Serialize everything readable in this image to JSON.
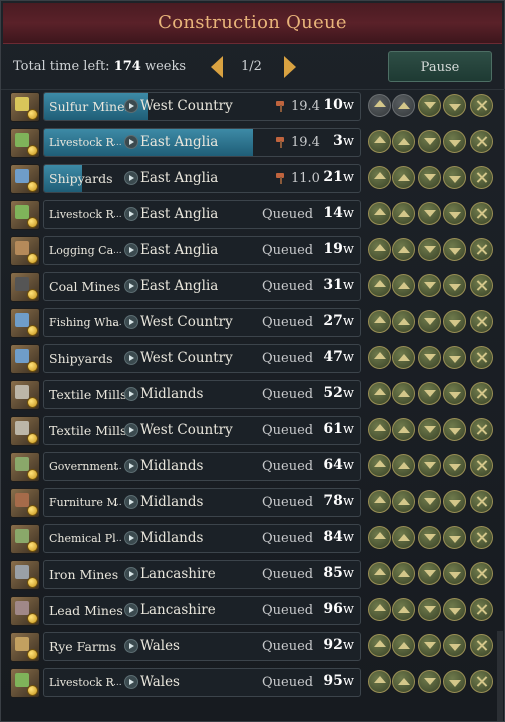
{
  "title": "Construction Queue",
  "total_time": {
    "label": "Total time left:",
    "value": "174",
    "unit": "weeks"
  },
  "page_indicator": "1/2",
  "pause_label": "Pause",
  "rows": [
    {
      "building": "Sulfur Mines",
      "state": "West Country",
      "status": "",
      "rate": "19.4",
      "weeks": "10",
      "unit": "w",
      "progress": 0.33,
      "icon": "sulfur-mine-icon",
      "small": false
    },
    {
      "building": "Livestock R",
      "state": "East Anglia",
      "status": "",
      "rate": "19.4",
      "weeks": "3",
      "unit": "w",
      "progress": 0.66,
      "icon": "livestock-ranch-icon",
      "small": true
    },
    {
      "building": "Shipyards",
      "state": "East Anglia",
      "status": "",
      "rate": "11.0",
      "weeks": "21",
      "unit": "w",
      "progress": 0.12,
      "icon": "shipyard-icon",
      "small": false
    },
    {
      "building": "Livestock R",
      "state": "East Anglia",
      "status": "Queued",
      "rate": "",
      "weeks": "14",
      "unit": "w",
      "progress": 0,
      "icon": "livestock-ranch-icon",
      "small": true
    },
    {
      "building": "Logging Ca",
      "state": "East Anglia",
      "status": "Queued",
      "rate": "",
      "weeks": "19",
      "unit": "w",
      "progress": 0,
      "icon": "logging-camp-icon",
      "small": true
    },
    {
      "building": "Coal Mines",
      "state": "East Anglia",
      "status": "Queued",
      "rate": "",
      "weeks": "31",
      "unit": "w",
      "progress": 0,
      "icon": "coal-mine-icon",
      "small": false
    },
    {
      "building": "Fishing Wha",
      "state": "West Country",
      "status": "Queued",
      "rate": "",
      "weeks": "27",
      "unit": "w",
      "progress": 0,
      "icon": "fishing-wharf-icon",
      "small": true
    },
    {
      "building": "Shipyards",
      "state": "West Country",
      "status": "Queued",
      "rate": "",
      "weeks": "47",
      "unit": "w",
      "progress": 0,
      "icon": "shipyard-icon",
      "small": false
    },
    {
      "building": "Textile Mills",
      "state": "Midlands",
      "status": "Queued",
      "rate": "",
      "weeks": "52",
      "unit": "w",
      "progress": 0,
      "icon": "textile-mill-icon",
      "small": false
    },
    {
      "building": "Textile Mills",
      "state": "West Country",
      "status": "Queued",
      "rate": "",
      "weeks": "61",
      "unit": "w",
      "progress": 0,
      "icon": "textile-mill-icon",
      "small": false
    },
    {
      "building": "Government",
      "state": "Midlands",
      "status": "Queued",
      "rate": "",
      "weeks": "64",
      "unit": "w",
      "progress": 0,
      "icon": "government-admin-icon",
      "small": true
    },
    {
      "building": "Furniture M",
      "state": "Midlands",
      "status": "Queued",
      "rate": "",
      "weeks": "78",
      "unit": "w",
      "progress": 0,
      "icon": "furniture-manufactory-icon",
      "small": true
    },
    {
      "building": "Chemical Pl",
      "state": "Midlands",
      "status": "Queued",
      "rate": "",
      "weeks": "84",
      "unit": "w",
      "progress": 0,
      "icon": "chemical-plant-icon",
      "small": true
    },
    {
      "building": "Iron Mines",
      "state": "Lancashire",
      "status": "Queued",
      "rate": "",
      "weeks": "85",
      "unit": "w",
      "progress": 0,
      "icon": "iron-mine-icon",
      "small": false
    },
    {
      "building": "Lead Mines",
      "state": "Lancashire",
      "status": "Queued",
      "rate": "",
      "weeks": "96",
      "unit": "w",
      "progress": 0,
      "icon": "lead-mine-icon",
      "small": false
    },
    {
      "building": "Rye Farms",
      "state": "Wales",
      "status": "Queued",
      "rate": "",
      "weeks": "92",
      "unit": "w",
      "progress": 0,
      "icon": "rye-farm-icon",
      "small": false
    },
    {
      "building": "Livestock R",
      "state": "Wales",
      "status": "Queued",
      "rate": "",
      "weeks": "95",
      "unit": "w",
      "progress": 0,
      "icon": "livestock-ranch-icon",
      "small": true
    }
  ],
  "colors": {
    "accent": "#e8b47a",
    "progress": "#2f7a96",
    "button": "#5f6b3f"
  }
}
